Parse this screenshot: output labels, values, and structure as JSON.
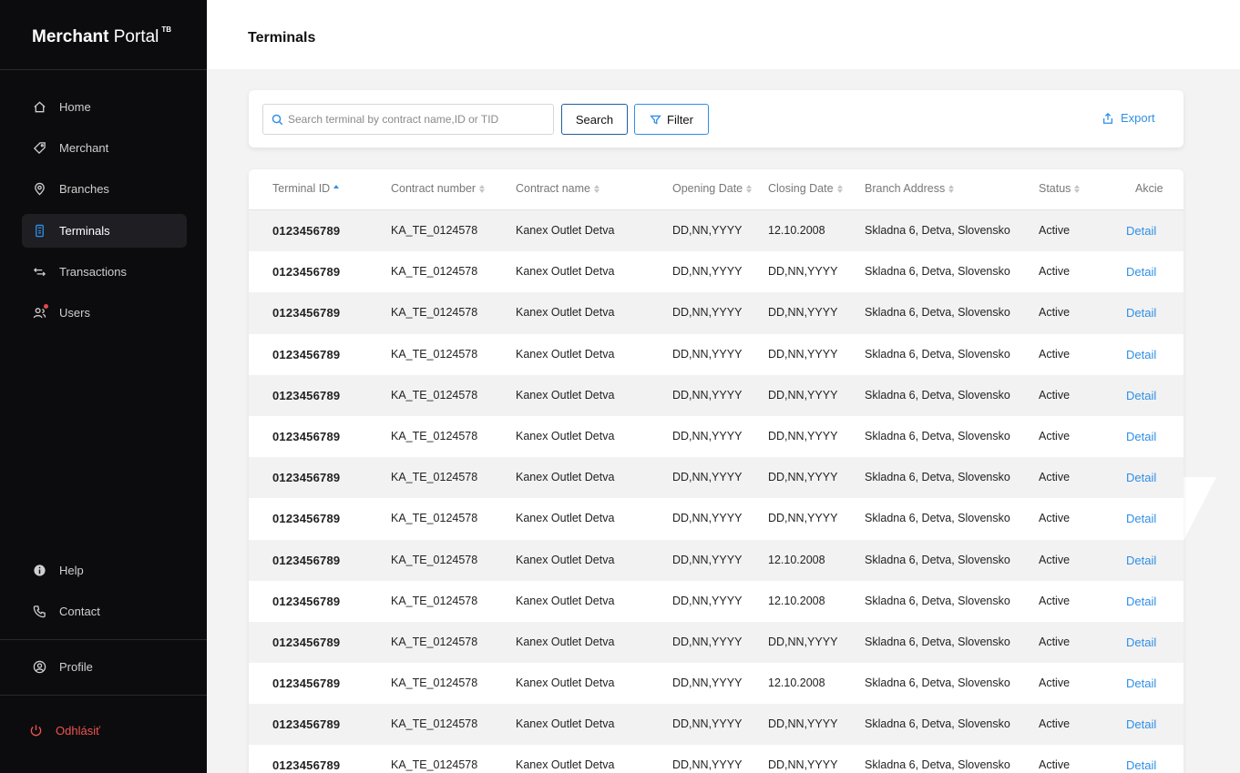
{
  "brand": {
    "bold": "Merchant",
    "light": "Portal",
    "badge": "TB"
  },
  "nav": {
    "home": "Home",
    "merchant": "Merchant",
    "branches": "Branches",
    "terminals": "Terminals",
    "transactions": "Transactions",
    "users": "Users",
    "help": "Help",
    "contact": "Contact",
    "profile": "Profile",
    "logout": "Odhlásiť"
  },
  "header": {
    "title": "Terminals"
  },
  "toolbar": {
    "search_placeholder": "Search terminal by contract name,ID or TID",
    "search_label": "Search",
    "filter_label": "Filter",
    "export_label": "Export"
  },
  "colors": {
    "accent": "#2f8fe6",
    "sidebar": "#0c0c0e",
    "logout": "#ef5350"
  },
  "table": {
    "columns": [
      "Terminal ID",
      "Contract number",
      "Contract name",
      "Opening Date",
      "Closing Date",
      "Branch Address",
      "Status",
      "Akcie"
    ],
    "rows": [
      [
        "0123456789",
        "KA_TE_0124578",
        "Kanex Outlet Detva",
        "DD,NN,YYYY",
        "12.10.2008",
        "Skladna 6, Detva, Slovensko",
        "Active",
        "Detail"
      ],
      [
        "0123456789",
        "KA_TE_0124578",
        "Kanex Outlet Detva",
        "DD,NN,YYYY",
        "DD,NN,YYYY",
        "Skladna 6, Detva, Slovensko",
        "Active",
        "Detail"
      ],
      [
        "0123456789",
        "KA_TE_0124578",
        "Kanex Outlet Detva",
        "DD,NN,YYYY",
        "DD,NN,YYYY",
        "Skladna 6, Detva, Slovensko",
        "Active",
        "Detail"
      ],
      [
        "0123456789",
        "KA_TE_0124578",
        "Kanex Outlet Detva",
        "DD,NN,YYYY",
        "DD,NN,YYYY",
        "Skladna 6, Detva, Slovensko",
        "Active",
        "Detail"
      ],
      [
        "0123456789",
        "KA_TE_0124578",
        "Kanex Outlet Detva",
        "DD,NN,YYYY",
        "DD,NN,YYYY",
        "Skladna 6, Detva, Slovensko",
        "Active",
        "Detail"
      ],
      [
        "0123456789",
        "KA_TE_0124578",
        "Kanex Outlet Detva",
        "DD,NN,YYYY",
        "DD,NN,YYYY",
        "Skladna 6, Detva, Slovensko",
        "Active",
        "Detail"
      ],
      [
        "0123456789",
        "KA_TE_0124578",
        "Kanex Outlet Detva",
        "DD,NN,YYYY",
        "DD,NN,YYYY",
        "Skladna 6, Detva, Slovensko",
        "Active",
        "Detail"
      ],
      [
        "0123456789",
        "KA_TE_0124578",
        "Kanex Outlet Detva",
        "DD,NN,YYYY",
        "DD,NN,YYYY",
        "Skladna 6, Detva, Slovensko",
        "Active",
        "Detail"
      ],
      [
        "0123456789",
        "KA_TE_0124578",
        "Kanex Outlet Detva",
        "DD,NN,YYYY",
        "12.10.2008",
        "Skladna 6, Detva, Slovensko",
        "Active",
        "Detail"
      ],
      [
        "0123456789",
        "KA_TE_0124578",
        "Kanex Outlet Detva",
        "DD,NN,YYYY",
        "12.10.2008",
        "Skladna 6, Detva, Slovensko",
        "Active",
        "Detail"
      ],
      [
        "0123456789",
        "KA_TE_0124578",
        "Kanex Outlet Detva",
        "DD,NN,YYYY",
        "DD,NN,YYYY",
        "Skladna 6, Detva, Slovensko",
        "Active",
        "Detail"
      ],
      [
        "0123456789",
        "KA_TE_0124578",
        "Kanex Outlet Detva",
        "DD,NN,YYYY",
        "12.10.2008",
        "Skladna 6, Detva, Slovensko",
        "Active",
        "Detail"
      ],
      [
        "0123456789",
        "KA_TE_0124578",
        "Kanex Outlet Detva",
        "DD,NN,YYYY",
        "DD,NN,YYYY",
        "Skladna 6, Detva, Slovensko",
        "Active",
        "Detail"
      ],
      [
        "0123456789",
        "KA_TE_0124578",
        "Kanex Outlet Detva",
        "DD,NN,YYYY",
        "DD,NN,YYYY",
        "Skladna 6, Detva, Slovensko",
        "Active",
        "Detail"
      ]
    ]
  }
}
